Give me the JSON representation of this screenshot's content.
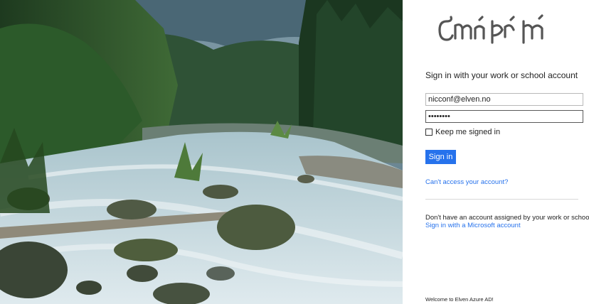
{
  "hero": {
    "image": "river-forest-landscape"
  },
  "signin": {
    "logo": "elvish-tengwar-logo",
    "heading": "Sign in with your work or school account",
    "email_value": "nicconf@elven.no",
    "password_value": "••••••••",
    "keep_signed_in_label": "Keep me signed in",
    "keep_signed_in_checked": false,
    "signin_button_label": "Sign in",
    "cant_access_link": "Can't access your account?",
    "no_account_text": "Don't have an account assigned by your work or school?",
    "microsoft_link": "Sign in with a Microsoft account",
    "footer_text": "Welcome to Elven Azure AD!"
  },
  "colors": {
    "accent": "#2672ec",
    "text": "#222222",
    "divider": "#d9d9d9"
  }
}
